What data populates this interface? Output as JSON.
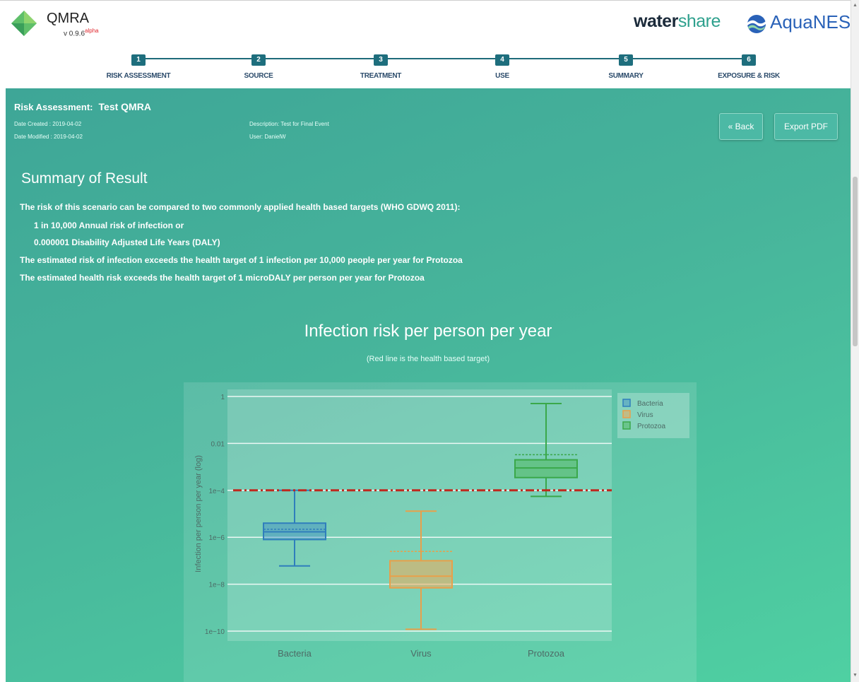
{
  "app": {
    "title": "QMRA",
    "version": "v 0.9.6",
    "version_tag": "alpha"
  },
  "brands": {
    "watershare_a": "water",
    "watershare_b": "share",
    "aquanes_a": "Aqua",
    "aquanes_b": "NES"
  },
  "steps": [
    {
      "num": "1",
      "label": "RISK ASSESSMENT"
    },
    {
      "num": "2",
      "label": "SOURCE"
    },
    {
      "num": "3",
      "label": "TREATMENT"
    },
    {
      "num": "4",
      "label": "USE"
    },
    {
      "num": "5",
      "label": "SUMMARY"
    },
    {
      "num": "6",
      "label": "EXPOSURE & RISK"
    }
  ],
  "assessment": {
    "label": "Risk Assessment:",
    "name": "Test QMRA",
    "date_created": "Date Created : 2019-04-02",
    "date_modified": "Date Modified : 2019-04-02",
    "description": "Description: Test for Final Event",
    "user": "User: DanielW"
  },
  "buttons": {
    "back": "« Back",
    "export": "Export PDF"
  },
  "summary": {
    "title": "Summary of Result",
    "lines": [
      "The risk of this scenario can be compared to two commonly applied health based targets (WHO GDWQ 2011):",
      "1 in 10,000 Annual risk of infection or",
      "0.000001 Disability Adjusted Life Years (DALY)",
      "The estimated risk of infection exceeds the health target of 1 infection per 10,000 people per year for Protozoa",
      "The estimated health risk exceeds the health target of 1 microDALY per person per year for Protozoa"
    ]
  },
  "colors": {
    "bacteria": "#2f7ebc",
    "virus": "#e8a04a",
    "protozoa": "#3aa84a",
    "target": "#c0281e"
  },
  "chart_data": {
    "type": "box",
    "title": "Infection risk per person per year",
    "subtitle": "(Red line is the health based target)",
    "ylabel": "Infection per person per year (log)",
    "yscale": "log",
    "ylim": [
      1e-10,
      1
    ],
    "ytick_labels": [
      "1",
      "0.01",
      "1e−4",
      "1e−6",
      "1e−8",
      "1e−10"
    ],
    "categories": [
      "Bacteria",
      "Virus",
      "Protozoa"
    ],
    "legend": [
      "Bacteria",
      "Virus",
      "Protozoa"
    ],
    "legend_position": "top-right",
    "target": 0.0001,
    "series": [
      {
        "name": "Bacteria",
        "min": 6e-08,
        "q1": 8e-07,
        "median": 1.7e-06,
        "q3": 4e-06,
        "max": 0.0001,
        "mean": 2.2e-06
      },
      {
        "name": "Virus",
        "min": 1.2e-10,
        "q1": 7e-09,
        "median": 2.2e-08,
        "q3": 1e-07,
        "max": 1.3e-05,
        "mean": 2.5e-07
      },
      {
        "name": "Protozoa",
        "min": 5.5e-05,
        "q1": 0.00035,
        "median": 0.0009,
        "q3": 0.002,
        "max": 0.5,
        "mean": 0.0033
      }
    ]
  }
}
